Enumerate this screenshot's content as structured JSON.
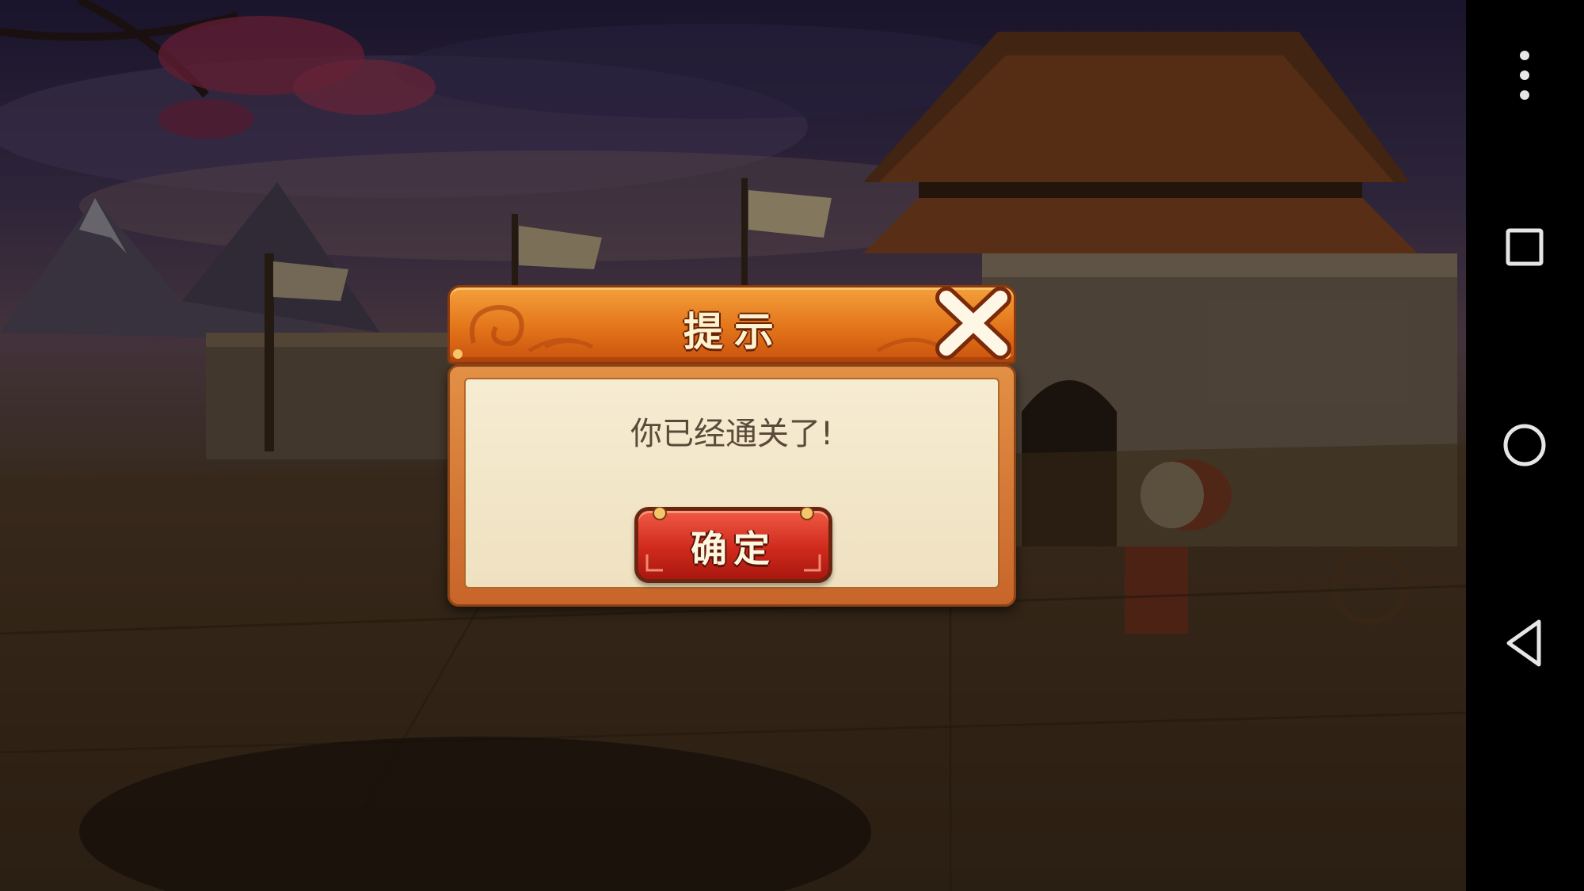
{
  "dialog": {
    "title": "提示",
    "message": "你已经通关了!",
    "confirm_label": "确定",
    "close_icon": "close-x-icon",
    "header_color": "#e3741a",
    "confirm_color": "#d02a1c",
    "body_color": "#f3e7c9"
  },
  "nav_bar": {
    "items": [
      {
        "name": "overflow-menu",
        "icon": "vertical-ellipsis-icon"
      },
      {
        "name": "recents",
        "icon": "square-icon"
      },
      {
        "name": "home",
        "icon": "circle-icon"
      },
      {
        "name": "back",
        "icon": "triangle-back-icon"
      }
    ]
  }
}
